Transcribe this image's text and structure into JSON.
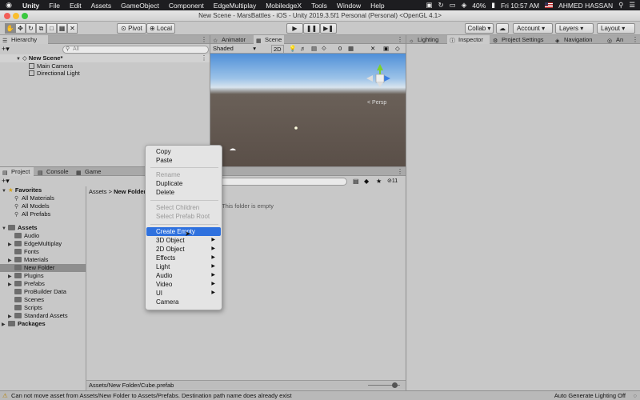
{
  "menubar": {
    "apple": "",
    "items": [
      "Unity",
      "File",
      "Edit",
      "Assets",
      "GameObject",
      "Component",
      "EdgeMultiplay",
      "MobiledgeX",
      "Tools",
      "Window",
      "Help"
    ],
    "battery": "40%",
    "clock": "Fri 10:57 AM",
    "user": "AHMED HASSAN"
  },
  "window": {
    "title": "New Scene - MarsBattles - iOS - Unity 2019.3.5f1 Personal (Personal) <OpenGL 4.1>"
  },
  "toolbar": {
    "pivot": "Pivot",
    "local": "Local",
    "collab": "Collab ▾",
    "account": "Account",
    "layers": "Layers",
    "layout": "Layout"
  },
  "hierarchy": {
    "tab": "Hierarchy",
    "search_placeholder": "All",
    "scene": "New Scene*",
    "items": [
      "Main Camera",
      "Directional Light"
    ]
  },
  "scene_panel": {
    "tabs": [
      "Animator",
      "Scene"
    ],
    "shading": "Shaded",
    "mode2d": "2D",
    "fx_count": "0",
    "persp": "< Persp"
  },
  "inspector": {
    "tabs": [
      "Lighting",
      "Inspector",
      "Project Settings",
      "Navigation",
      "An"
    ]
  },
  "project": {
    "tabs": [
      "Project",
      "Console",
      "Game"
    ],
    "favorites_label": "Favorites",
    "favorites": [
      "All Materials",
      "All Models",
      "All Prefabs"
    ],
    "assets_label": "Assets",
    "assets": [
      "Audio",
      "EdgeMultiplay",
      "Fonts",
      "Materials",
      "New Folder",
      "Plugins",
      "Prefabs",
      "ProBuilder Data",
      "Scenes",
      "Scripts",
      "Standard Assets"
    ],
    "packages_label": "Packages",
    "breadcrumb_root": "Assets",
    "breadcrumb_sep": ">",
    "breadcrumb_current": "New Folder",
    "empty_text": "This folder is empty",
    "hidden_count": "11",
    "path": "Assets/New Folder/Cube.prefab"
  },
  "context_menu": {
    "copy": "Copy",
    "paste": "Paste",
    "rename": "Rename",
    "duplicate": "Duplicate",
    "delete": "Delete",
    "select_children": "Select Children",
    "select_prefab_root": "Select Prefab Root",
    "create_empty": "Create Empty",
    "object3d": "3D Object",
    "object2d": "2D Object",
    "effects": "Effects",
    "light": "Light",
    "audio": "Audio",
    "video": "Video",
    "ui": "UI",
    "camera": "Camera"
  },
  "status": {
    "message": "Can not move asset from Assets/New Folder to Assets/Prefabs. Destination path name does already exist",
    "lighting": "Auto Generate Lighting Off"
  },
  "colors": {
    "highlight": "#2f71de",
    "selected_row": "#8e8e8e",
    "panel": "#c8c8c8"
  }
}
